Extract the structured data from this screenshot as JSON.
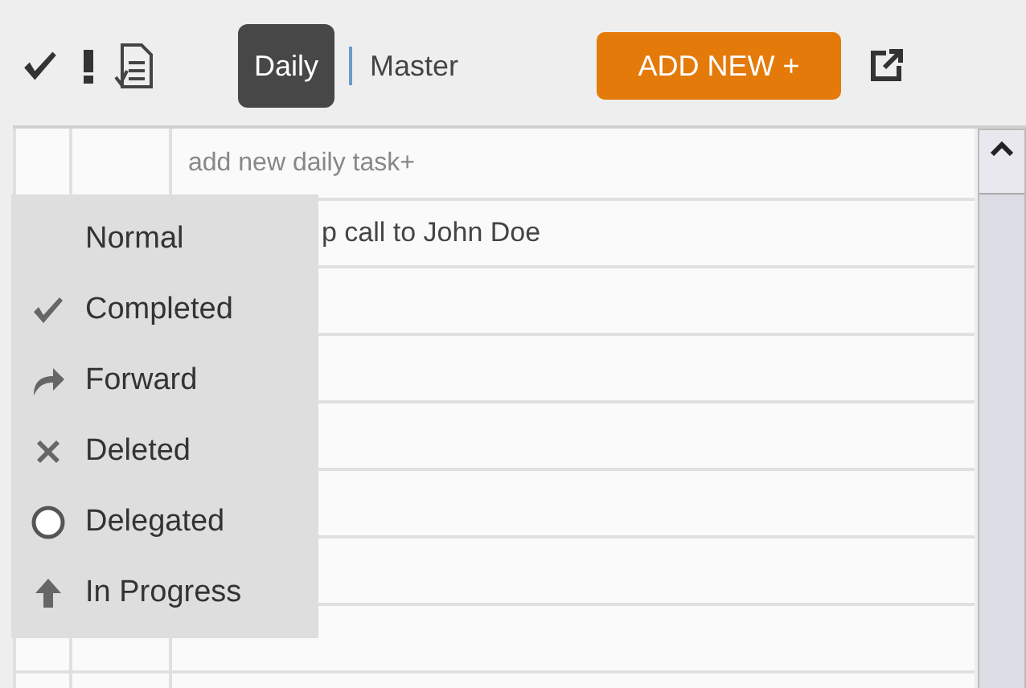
{
  "toolbar": {
    "tabs": [
      {
        "label": "Daily",
        "selected": true
      },
      {
        "label": "Master",
        "selected": false
      }
    ],
    "add_button": "ADD NEW +"
  },
  "table": {
    "new_task_placeholder": "add new daily task+",
    "tasks": [
      {
        "text": "p call to John Doe"
      }
    ]
  },
  "status_menu": {
    "items": [
      {
        "kind": "normal",
        "label": "Normal"
      },
      {
        "kind": "completed",
        "label": "Completed"
      },
      {
        "kind": "forward",
        "label": "Forward"
      },
      {
        "kind": "deleted",
        "label": "Deleted"
      },
      {
        "kind": "delegated",
        "label": "Delegated"
      },
      {
        "kind": "progress",
        "label": "In Progress"
      }
    ]
  }
}
